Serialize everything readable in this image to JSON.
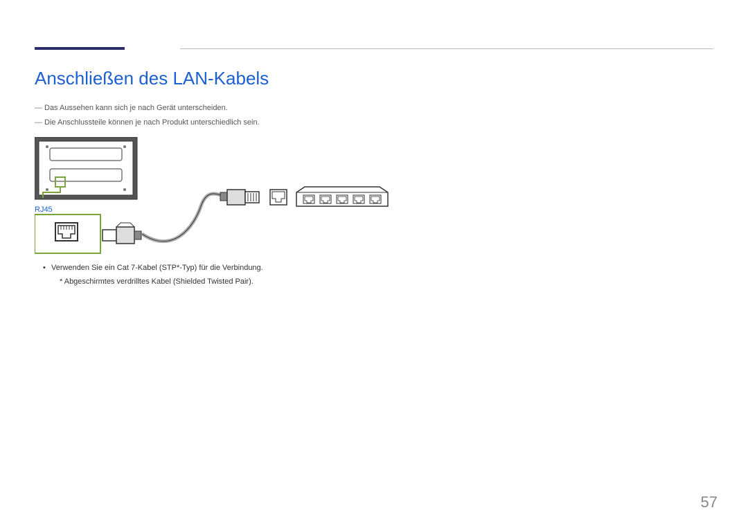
{
  "title": "Anschließen des LAN-Kabels",
  "notes": [
    "Das Aussehen kann sich je nach Gerät unterscheiden.",
    "Die Anschlussteile können je nach Produkt unterschiedlich sein."
  ],
  "diagram": {
    "port_label": "RJ45"
  },
  "bullets": {
    "line1": "Verwenden Sie ein Cat 7-Kabel (STP*-Typ) für die Verbindung.",
    "line2": "* Abgeschirmtes verdrilltes Kabel (Shielded Twisted Pair)."
  },
  "page_number": "57"
}
